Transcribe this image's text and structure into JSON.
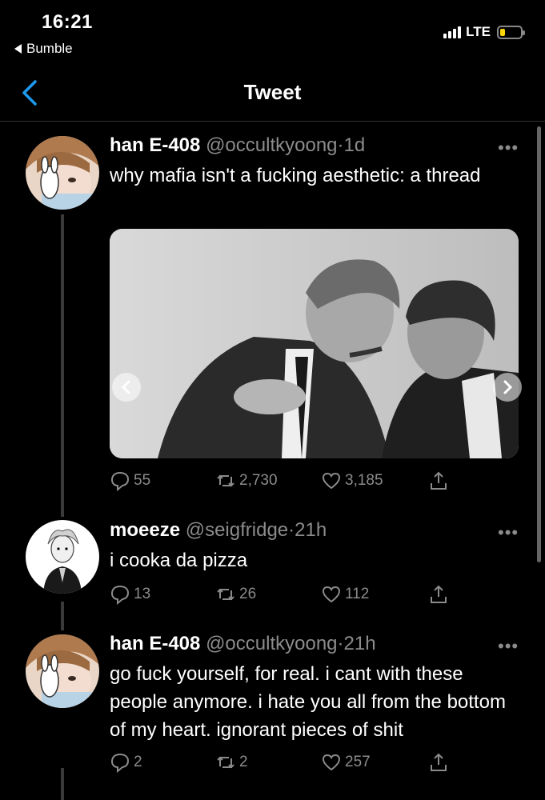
{
  "status_bar": {
    "time": "16:21",
    "back_app": "Bumble",
    "network": "LTE",
    "battery_color": "#ffd60a"
  },
  "nav": {
    "title": "Tweet",
    "accent": "#1d9bf0"
  },
  "tweets": [
    {
      "name": "han E-408",
      "handle": "@occultkyoong",
      "dot": "·",
      "time": "1d",
      "text": "why mafia isn't a fucking aesthetic: a thread",
      "replies": "55",
      "retweets": "2,730",
      "likes": "3,185"
    },
    {
      "name": "moeeze",
      "handle": "@seigfridge",
      "dot": "·",
      "time": "21h",
      "text": "i cooka da pizza",
      "replies": "13",
      "retweets": "26",
      "likes": "112"
    },
    {
      "name": "han E-408",
      "handle": "@occultkyoong",
      "dot": "·",
      "time": "21h",
      "text": "go fuck yourself, for real. i cant with these people anymore. i hate you all from the bottom of my heart. ignorant pieces of shit",
      "replies": "2",
      "retweets": "2",
      "likes": "257"
    }
  ],
  "icons": {
    "reply": "reply-icon",
    "retweet": "retweet-icon",
    "like": "heart-icon",
    "share": "share-icon",
    "more": "more-icon"
  },
  "more_glyph": "•••"
}
